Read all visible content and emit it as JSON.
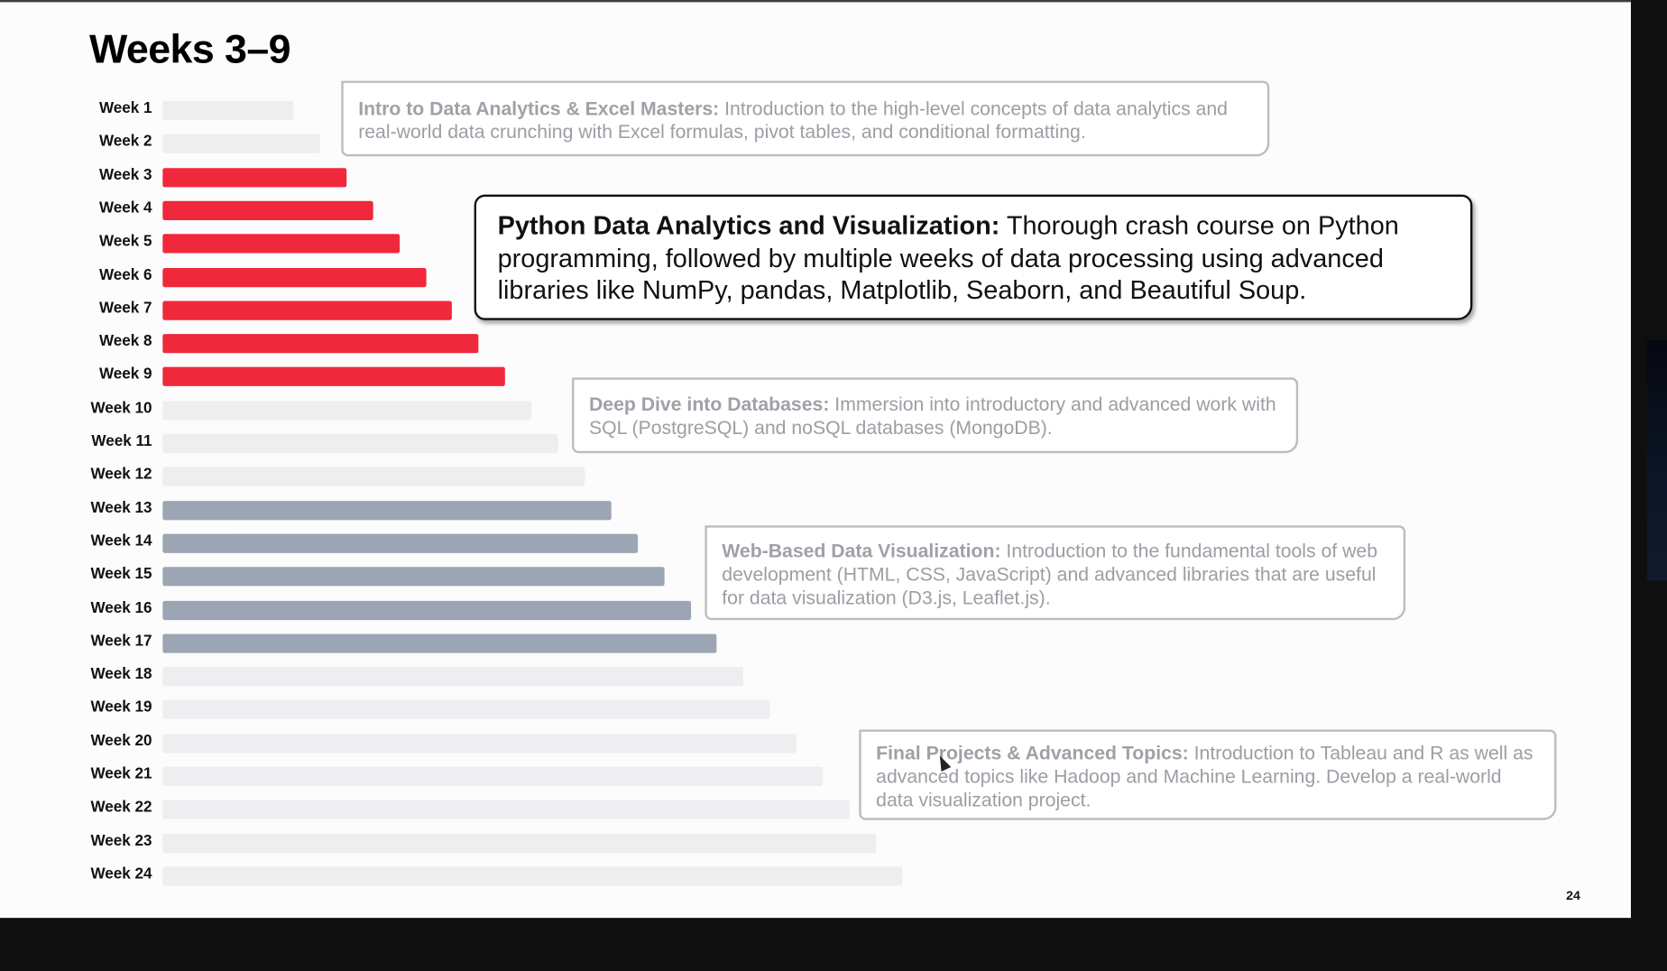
{
  "slide": {
    "title": "Weeks 3–9",
    "page_number": "24",
    "colors": {
      "inactive_bar": "#eeeef0",
      "active_bar": "#f0283c",
      "upcoming_bar": "#9ba5b4"
    }
  },
  "weeks": [
    {
      "label": "Week 1",
      "state": "inactive"
    },
    {
      "label": "Week 2",
      "state": "inactive"
    },
    {
      "label": "Week 3",
      "state": "active"
    },
    {
      "label": "Week 4",
      "state": "active"
    },
    {
      "label": "Week 5",
      "state": "active"
    },
    {
      "label": "Week 6",
      "state": "active"
    },
    {
      "label": "Week 7",
      "state": "active"
    },
    {
      "label": "Week 8",
      "state": "active"
    },
    {
      "label": "Week 9",
      "state": "active"
    },
    {
      "label": "Week 10",
      "state": "inactive"
    },
    {
      "label": "Week 11",
      "state": "inactive"
    },
    {
      "label": "Week 12",
      "state": "inactive"
    },
    {
      "label": "Week 13",
      "state": "upcoming"
    },
    {
      "label": "Week 14",
      "state": "upcoming"
    },
    {
      "label": "Week 15",
      "state": "upcoming"
    },
    {
      "label": "Week 16",
      "state": "upcoming"
    },
    {
      "label": "Week 17",
      "state": "upcoming"
    },
    {
      "label": "Week 18",
      "state": "inactive"
    },
    {
      "label": "Week 19",
      "state": "inactive"
    },
    {
      "label": "Week 20",
      "state": "inactive"
    },
    {
      "label": "Week 21",
      "state": "inactive"
    },
    {
      "label": "Week 22",
      "state": "inactive"
    },
    {
      "label": "Week 23",
      "state": "inactive"
    },
    {
      "label": "Week 24",
      "state": "inactive"
    }
  ],
  "modules": [
    {
      "heading": "Intro to Data Analytics & Excel Masters:",
      "text": " Introduction to the high-level concepts of data analytics and real-world data crunching with Excel formulas, pivot tables, and conditional formatting."
    },
    {
      "heading": "Python Data Analytics and Visualization:",
      "text": " Thorough crash course on Python programming, followed by multiple weeks of data processing using advanced libraries like NumPy, pandas, Matplotlib, Seaborn, and Beautiful Soup."
    },
    {
      "heading": "Deep Dive into Databases:",
      "text": " Immersion into introductory and advanced work with SQL (PostgreSQL) and noSQL databases (MongoDB)."
    },
    {
      "heading": "Web-Based Data Visualization:",
      "text": " Introduction to the fundamental tools of web development (HTML, CSS, JavaScript) and advanced libraries that are useful for data visualization (D3.js, Leaflet.js)."
    },
    {
      "heading": "Final Projects & Advanced Topics:",
      "text": " Introduction to Tableau and R as well as advanced topics like Hadoop and Machine Learning. Develop a real-world data visualization project."
    }
  ]
}
